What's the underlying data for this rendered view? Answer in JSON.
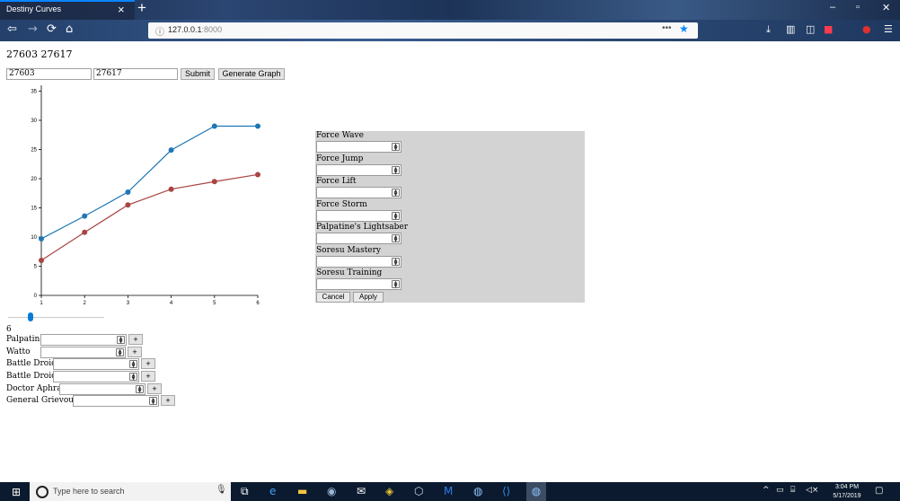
{
  "browser": {
    "tab_title": "Destiny Curves",
    "tab_close": "×",
    "new_tab": "+",
    "url_host": "127.0.0.1",
    "url_port": ":8000",
    "url_dots": "•••",
    "window_min": "–",
    "window_restore": "▫",
    "window_close": "✕",
    "icons": [
      "back-icon",
      "forward-icon",
      "reload-icon",
      "home-icon",
      "info-icon",
      "star-icon",
      "download-icon",
      "library-icon",
      "sidebar-icon",
      "pocket-icon",
      "ublock-icon",
      "menu-icon"
    ]
  },
  "page": {
    "ids_heading": "27603 27617",
    "input_a": "27603",
    "input_b": "27617",
    "submit_label": "Submit",
    "generate_label": "Generate Graph",
    "slider_value": 6,
    "slider_display": "6",
    "slider_fraction": 0.23,
    "add_label": "+",
    "characters": [
      {
        "name": "Palpatine"
      },
      {
        "name": "Watto"
      },
      {
        "name": "Battle Droid"
      },
      {
        "name": "Battle Droid"
      },
      {
        "name": "Doctor Aphra"
      },
      {
        "name": "General Grievous"
      }
    ]
  },
  "chart_data": {
    "type": "line",
    "x": [
      1,
      2,
      3,
      4,
      5,
      6
    ],
    "ylim": [
      0,
      36
    ],
    "yticks": [
      0,
      5,
      10,
      15,
      20,
      25,
      30,
      35
    ],
    "series": [
      {
        "values": [
          9.7,
          13.6,
          17.7,
          24.9,
          29,
          29
        ],
        "color": "#1f77b4"
      },
      {
        "values": [
          6,
          10.8,
          15.5,
          18.2,
          19.5,
          20.7
        ],
        "color": "#a94442"
      }
    ]
  },
  "panel": {
    "upgrades": [
      "Force Wave",
      "Force Jump",
      "Force Lift",
      "Force Storm",
      "Palpatine's Lightsaber",
      "Soresu Mastery",
      "Soresu Training"
    ],
    "cancel_label": "Cancel",
    "apply_label": "Apply",
    "background": "#d3d3d3"
  },
  "taskbar": {
    "search_placeholder": "Type here to search",
    "time": "3:04 PM",
    "date": "5/17/2019"
  }
}
